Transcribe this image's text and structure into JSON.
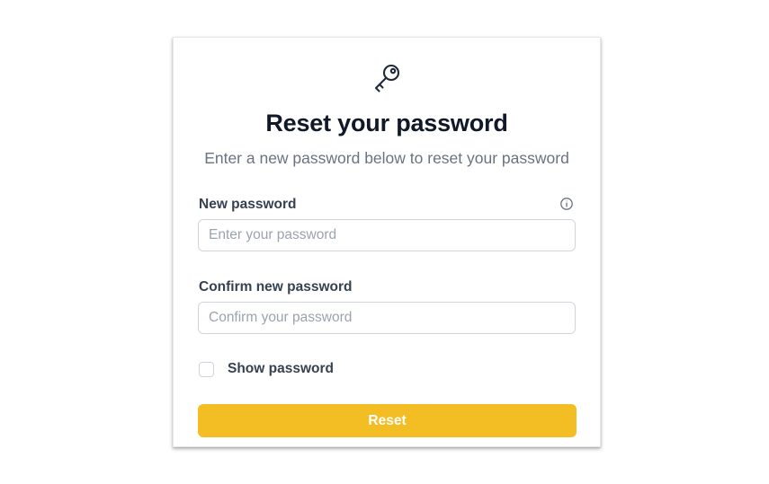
{
  "form": {
    "title": "Reset your password",
    "subtitle": "Enter a new password below to reset your password",
    "header_icon": "key-icon",
    "new_password": {
      "label": "New password",
      "placeholder": "Enter your password",
      "value": "",
      "help_icon": "info-icon"
    },
    "confirm_password": {
      "label": "Confirm new password",
      "placeholder": "Confirm your password",
      "value": ""
    },
    "show_password": {
      "label": "Show password",
      "checked": false
    },
    "submit_label": "Reset"
  },
  "colors": {
    "accent": "#f3bd24",
    "title": "#111827",
    "subtitle": "#6b7280",
    "label": "#374151",
    "placeholder": "#9ca3af",
    "border": "#d1d5db"
  }
}
